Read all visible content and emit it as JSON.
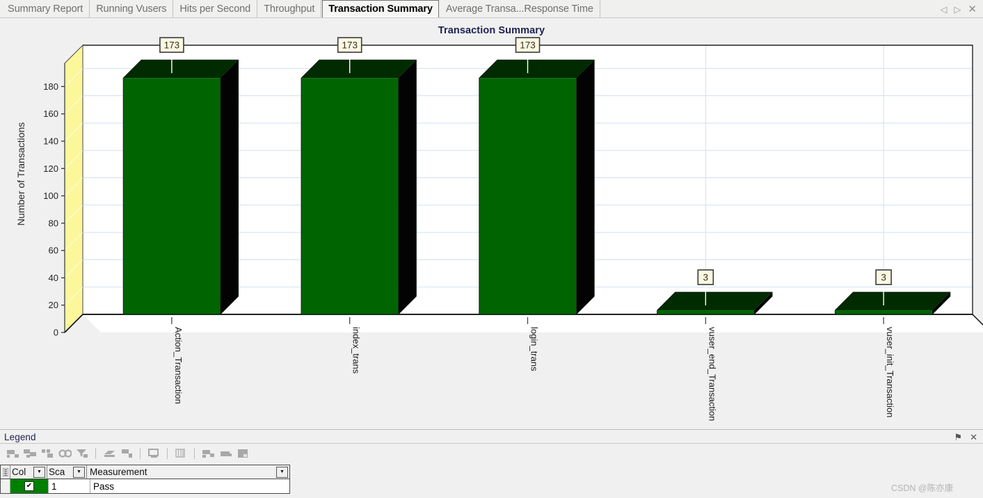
{
  "window": {
    "tabs": [
      {
        "label": "Summary Report",
        "active": false
      },
      {
        "label": "Running Vusers",
        "active": false
      },
      {
        "label": "Hits per Second",
        "active": false
      },
      {
        "label": "Throughput",
        "active": false
      },
      {
        "label": "Transaction Summary",
        "active": true
      },
      {
        "label": "Average Transa...Response Time",
        "active": false
      }
    ],
    "nav": {
      "prev": "◁",
      "next": "▷",
      "close": "✕"
    }
  },
  "legend_panel": {
    "title": "Legend",
    "dock": {
      "pin": "⚑",
      "close": "✕"
    },
    "columns": [
      "",
      "Col",
      "Sca",
      "Measurement"
    ],
    "dropdown_glyph": "▼",
    "rows": [
      {
        "color": "#008000",
        "checked": true,
        "check_glyph": "✔",
        "scale": "1",
        "measurement": "Pass"
      }
    ]
  },
  "watermark": "CSDN @陈亦康",
  "chart_data": {
    "type": "bar",
    "title": "Transaction Summary",
    "xlabel": "",
    "ylabel": "Number of Transactions",
    "categories": [
      "Action_Transaction",
      "index_trans",
      "login_trans",
      "vuser_end_Transaction",
      "vuser_init_Transaction"
    ],
    "values": [
      173,
      173,
      173,
      3,
      3
    ],
    "value_labels": [
      "173",
      "173",
      "173",
      "3",
      "3"
    ],
    "yticks": [
      0,
      20,
      40,
      60,
      80,
      100,
      120,
      140,
      160,
      180
    ],
    "ytick_labels": [
      "0",
      "20",
      "40",
      "60",
      "80",
      "100",
      "120",
      "140",
      "160",
      "180"
    ],
    "ylim": [
      0,
      197
    ],
    "grid": true,
    "legend_position": "bottom-dock",
    "series": [
      {
        "name": "Pass",
        "color": "#006400",
        "values": [
          173,
          173,
          173,
          3,
          3
        ]
      }
    ],
    "colors": {
      "bar_front": "#006400",
      "bar_top": "#002b00",
      "bar_side": "#030303",
      "wall": "#ffffff",
      "side_wall": "#fbf79a",
      "gridline": "#cfe0f2",
      "frame": "#222222",
      "label_box_fill": "#fbf8e3",
      "label_box_border": "#3b3b3b",
      "title": "#1d2154"
    }
  }
}
